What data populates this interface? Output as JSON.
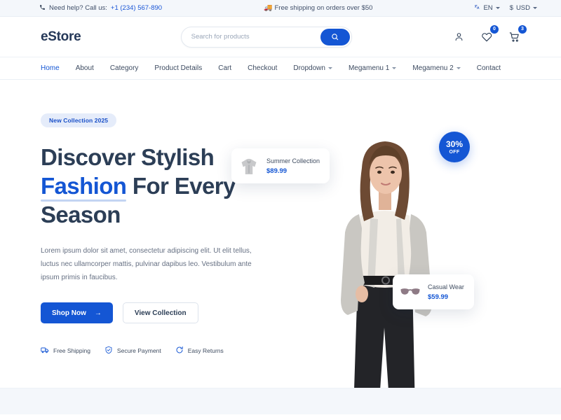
{
  "topbar": {
    "phone_icon": "phone-icon",
    "help_text": "Need help? Call us:",
    "phone": "+1 (234) 567-890",
    "shipping_icon": "🚚",
    "shipping_text": "Free shipping on orders over $50",
    "language_icon": "translate-icon",
    "language": "EN",
    "currency_symbol": "$",
    "currency": "USD"
  },
  "header": {
    "logo": "eStore",
    "search_placeholder": "Search for products",
    "search_value": "",
    "search_icon": "search-icon",
    "account_icon": "user-icon",
    "wishlist_icon": "heart-icon",
    "wishlist_count": "0",
    "cart_icon": "cart-icon",
    "cart_count": "3"
  },
  "nav": {
    "items": [
      {
        "label": "Home",
        "active": true,
        "dropdown": false
      },
      {
        "label": "About",
        "active": false,
        "dropdown": false
      },
      {
        "label": "Category",
        "active": false,
        "dropdown": false
      },
      {
        "label": "Product Details",
        "active": false,
        "dropdown": false
      },
      {
        "label": "Cart",
        "active": false,
        "dropdown": false
      },
      {
        "label": "Checkout",
        "active": false,
        "dropdown": false
      },
      {
        "label": "Dropdown",
        "active": false,
        "dropdown": true
      },
      {
        "label": "Megamenu 1",
        "active": false,
        "dropdown": true
      },
      {
        "label": "Megamenu 2",
        "active": false,
        "dropdown": true
      },
      {
        "label": "Contact",
        "active": false,
        "dropdown": false
      }
    ]
  },
  "hero": {
    "badge": "New Collection 2025",
    "title_line1": "Discover Stylish",
    "title_highlight": "Fashion",
    "title_line2_rest": " For Every",
    "title_line3": "Season",
    "description": "Lorem ipsum dolor sit amet, consectetur adipiscing elit. Ut elit tellus, luctus nec ullamcorper mattis, pulvinar dapibus leo. Vestibulum ante ipsum primis in faucibus.",
    "primary_cta": "Shop Now",
    "primary_cta_arrow": "→",
    "secondary_cta": "View Collection",
    "features": [
      {
        "icon": "truck-icon",
        "label": "Free Shipping"
      },
      {
        "icon": "shield-check-icon",
        "label": "Secure Payment"
      },
      {
        "icon": "refresh-icon",
        "label": "Easy Returns"
      }
    ],
    "cards": [
      {
        "icon": "hoodie-icon",
        "title": "Summer Collection",
        "price": "$89.99"
      },
      {
        "icon": "sunglasses-icon",
        "title": "Casual Wear",
        "price": "$59.99"
      }
    ],
    "discount": {
      "percent": "30%",
      "label": "OFF"
    }
  },
  "colors": {
    "accent": "#1456d4",
    "heading": "#2c3e56",
    "topbar_bg": "#f4f7fb",
    "badge_bg": "#e5ecfa"
  }
}
